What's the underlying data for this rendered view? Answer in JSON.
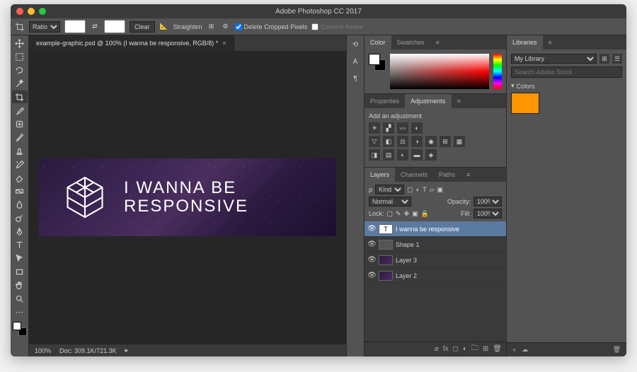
{
  "window": {
    "title": "Adobe Photoshop CC 2017"
  },
  "optionsBar": {
    "ratio_label": "Ratio",
    "clear_label": "Clear",
    "straighten_label": "Straighten",
    "delete_cropped_label": "Delete Cropped Pixels",
    "content_aware_label": "Content-Aware"
  },
  "document": {
    "tab_label": "example-graphic.psd @ 100% (I wanna be responsive, RGB/8) *",
    "artboard_text_line1": "I WANNA BE",
    "artboard_text_line2": "RESPONSIVE"
  },
  "status": {
    "zoom": "100%",
    "doc": "Doc: 309.1K/721.3K"
  },
  "panels": {
    "color_tab": "Color",
    "swatches_tab": "Swatches",
    "properties_tab": "Properties",
    "adjustments_tab": "Adjustments",
    "add_adjustment_label": "Add an adjustment",
    "layers_tab": "Layers",
    "channels_tab": "Channels",
    "paths_tab": "Paths"
  },
  "layers": {
    "kind_label": "Kind",
    "blend_mode": "Normal",
    "opacity_label": "Opacity:",
    "opacity_value": "100%",
    "lock_label": "Lock:",
    "fill_label": "Fill:",
    "fill_value": "100%",
    "items": [
      {
        "name": "I wanna be responsive",
        "type": "text"
      },
      {
        "name": "Shape 1",
        "type": "shape"
      },
      {
        "name": "Layer 3",
        "type": "raster"
      },
      {
        "name": "Layer 2",
        "type": "raster"
      }
    ]
  },
  "libraries": {
    "tab": "Libraries",
    "selected": "My Library",
    "search_placeholder": "Search Adobe Stock",
    "group_colors": "Colors",
    "swatch_color": "#ff9500"
  }
}
